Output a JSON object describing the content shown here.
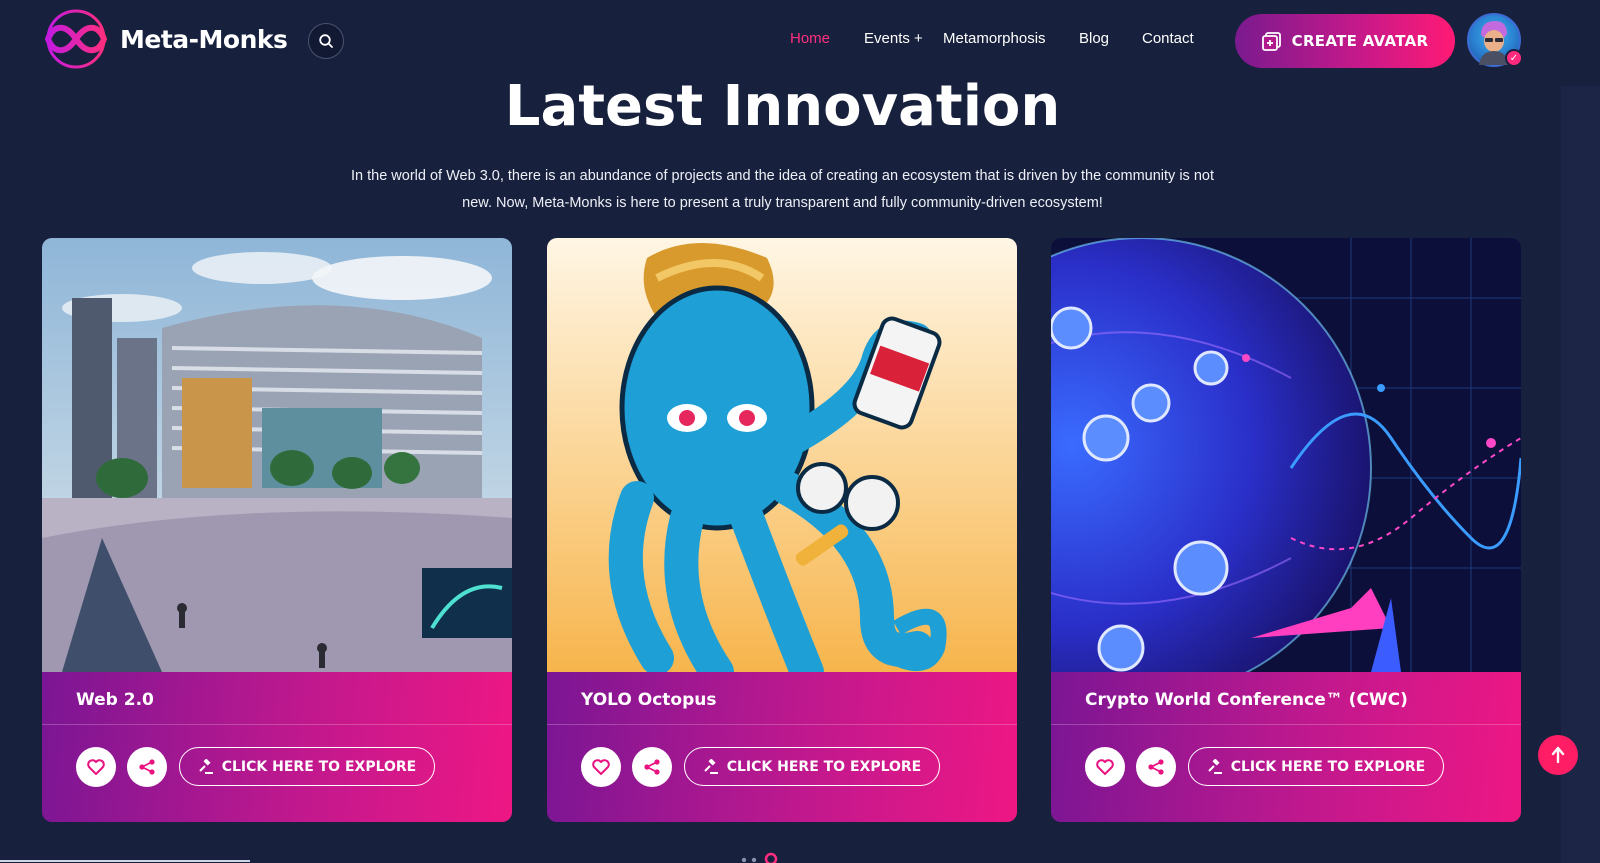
{
  "header": {
    "brand": "Meta-Monks",
    "nav": [
      {
        "label": "Home",
        "active": true
      },
      {
        "label": "Events +",
        "active": false
      },
      {
        "label": "Metamorphosis",
        "active": false
      },
      {
        "label": "Blog",
        "active": false
      },
      {
        "label": "Contact",
        "active": false
      }
    ],
    "cta_label": "CREATE AVATAR",
    "icons": {
      "search": "search-icon",
      "cta": "add-avatar-icon",
      "avatar_badge": "check-icon"
    }
  },
  "hero": {
    "title": "Latest Innovation",
    "description": "In the world of Web 3.0, there is an abundance of projects and the idea of creating an ecosystem that is driven by the community is not new. Now, Meta-Monks is here to present a truly transparent and fully community-driven ecosystem!"
  },
  "cards": [
    {
      "title": "Web 2.0",
      "explore_label": "CLICK HERE TO EXPLORE",
      "image": "futuristic-city-illustration"
    },
    {
      "title": "YOLO Octopus",
      "explore_label": "CLICK HERE TO EXPLORE",
      "image": "blue-octopus-illustration"
    },
    {
      "title": "Crypto World Conference™ (CWC)",
      "explore_label": "CLICK HERE TO EXPLORE",
      "image": "crypto-globe-illustration"
    }
  ],
  "colors": {
    "background": "#17203d",
    "accent": "#ff2e7e",
    "card_gradient_start": "#7b1694",
    "card_gradient_end": "#ee1784"
  }
}
